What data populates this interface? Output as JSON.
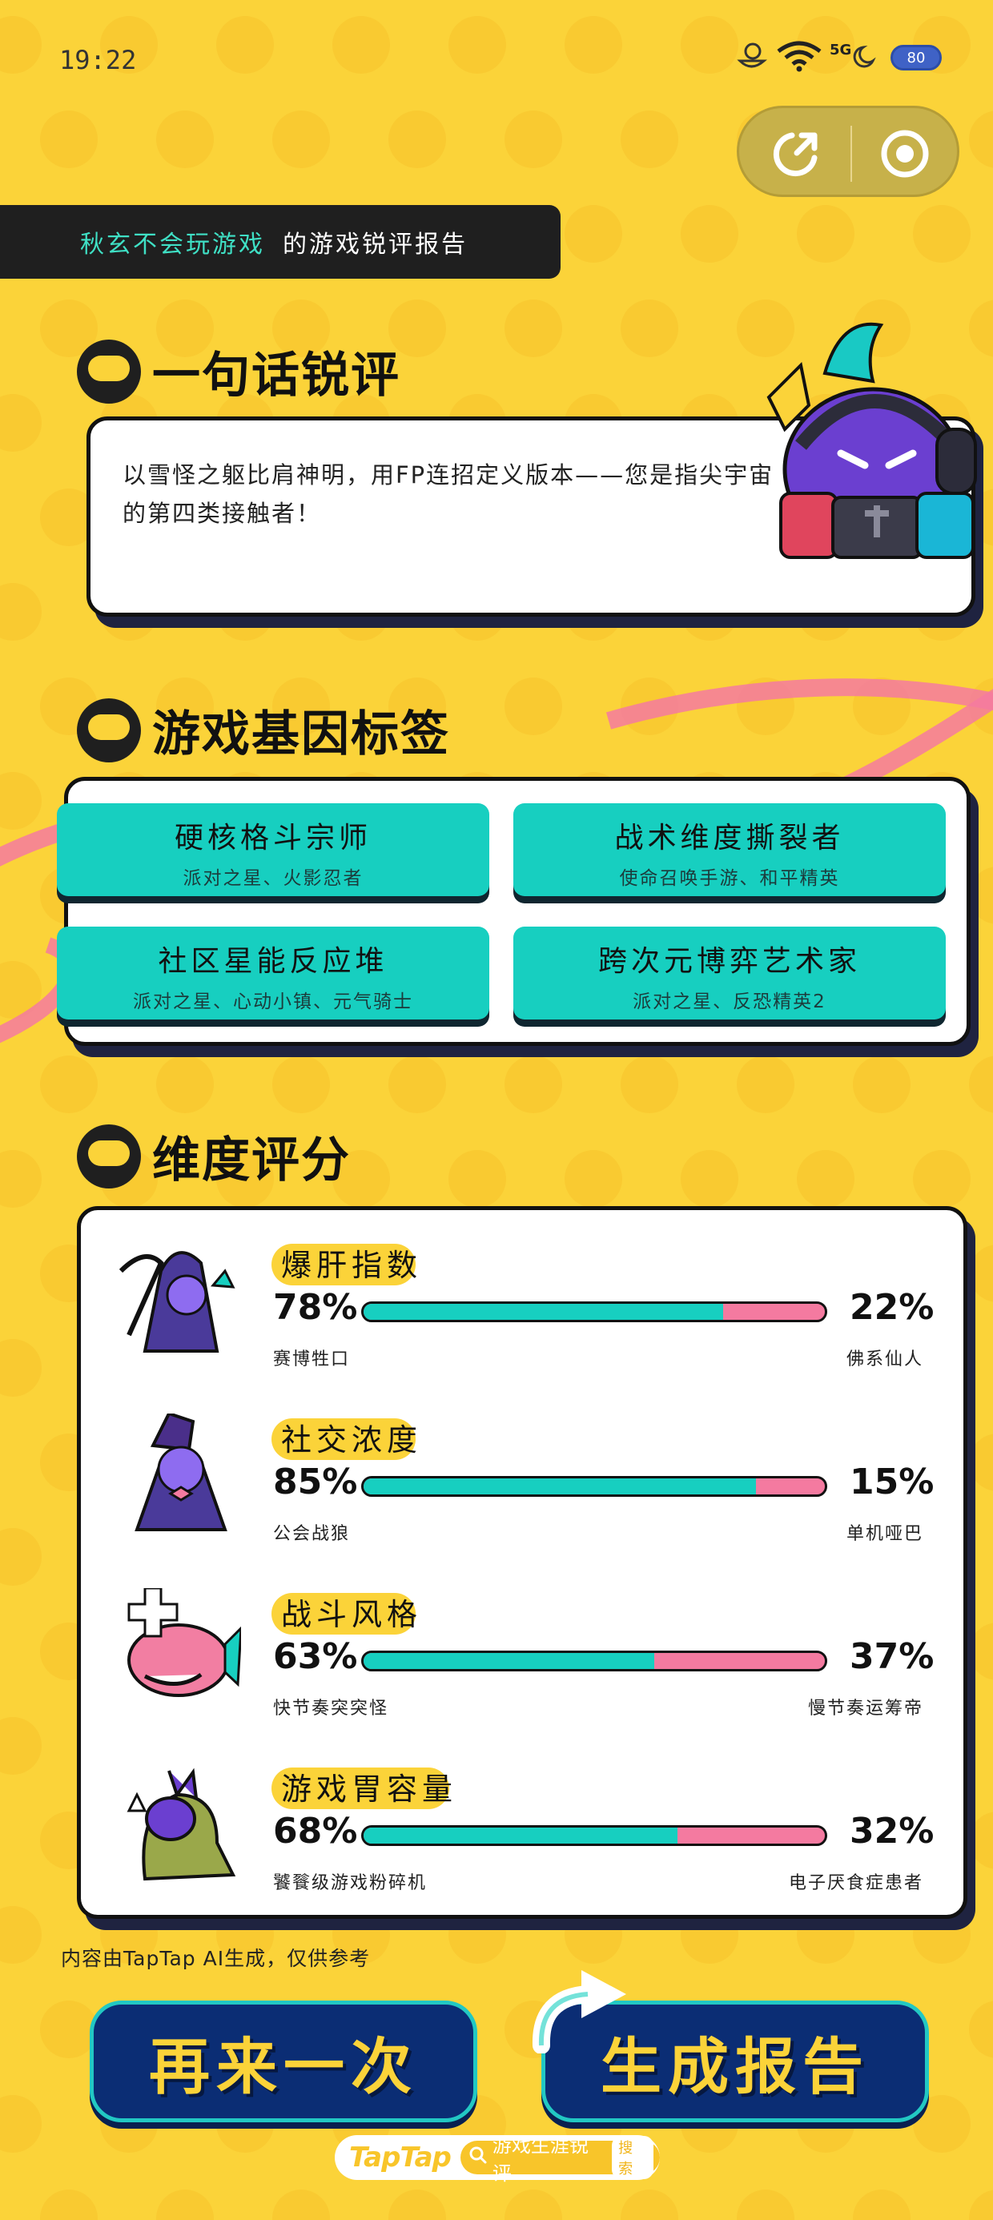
{
  "status_bar": {
    "time": "19:22",
    "network": "5G",
    "battery": "80"
  },
  "capsule": {
    "share_icon": "share-icon",
    "close_icon": "target-close-icon"
  },
  "banner": {
    "nickname": "秋玄不会玩游戏",
    "suffix": "的游戏锐评报告"
  },
  "review": {
    "title": "一句话锐评",
    "text": "以雪怪之躯比肩神明，用FP连招定义版本——您是指尖宇宙的第四类接触者！"
  },
  "tags": {
    "title": "游戏基因标签",
    "items": [
      {
        "title": "硬核格斗宗师",
        "games": "派对之星、火影忍者"
      },
      {
        "title": "战术维度撕裂者",
        "games": "使命召唤手游、和平精英"
      },
      {
        "title": "社区星能反应堆",
        "games": "派对之星、心动小镇、元气骑士"
      },
      {
        "title": "跨次元博弈艺术家",
        "games": "派对之星、反恐精英2"
      }
    ]
  },
  "dimensions": {
    "title": "维度评分",
    "items": [
      {
        "name": "爆肝指数",
        "left_pct": 78,
        "right_pct": 22,
        "left_label_pct": "78%",
        "right_label_pct": "22%",
        "left_label": "赛博牲口",
        "right_label": "佛系仙人"
      },
      {
        "name": "社交浓度",
        "left_pct": 85,
        "right_pct": 15,
        "left_label_pct": "85%",
        "right_label_pct": "15%",
        "left_label": "公会战狼",
        "right_label": "单机哑巴"
      },
      {
        "name": "战斗风格",
        "left_pct": 63,
        "right_pct": 37,
        "left_label_pct": "63%",
        "right_label_pct": "37%",
        "left_label": "快节奏突突怪",
        "right_label": "慢节奏运筹帝"
      },
      {
        "name": "游戏胃容量",
        "left_pct": 68,
        "right_pct": 32,
        "left_label_pct": "68%",
        "right_label_pct": "32%",
        "left_label": "饕餮级游戏粉碎机",
        "right_label": "电子厌食症患者"
      }
    ]
  },
  "disclaimer": "内容由TapTap AI生成，仅供参考",
  "buttons": {
    "retry": "再来一次",
    "generate": "生成报告"
  },
  "footer": {
    "logo": "TapTap",
    "search_text": "游戏生涯锐评",
    "badge": "搜索"
  },
  "colors": {
    "background": "#fbd339",
    "teal": "#17cfc0",
    "pink": "#f47aa0",
    "navy": "#0b2d74",
    "dark": "#1f1f1f"
  }
}
